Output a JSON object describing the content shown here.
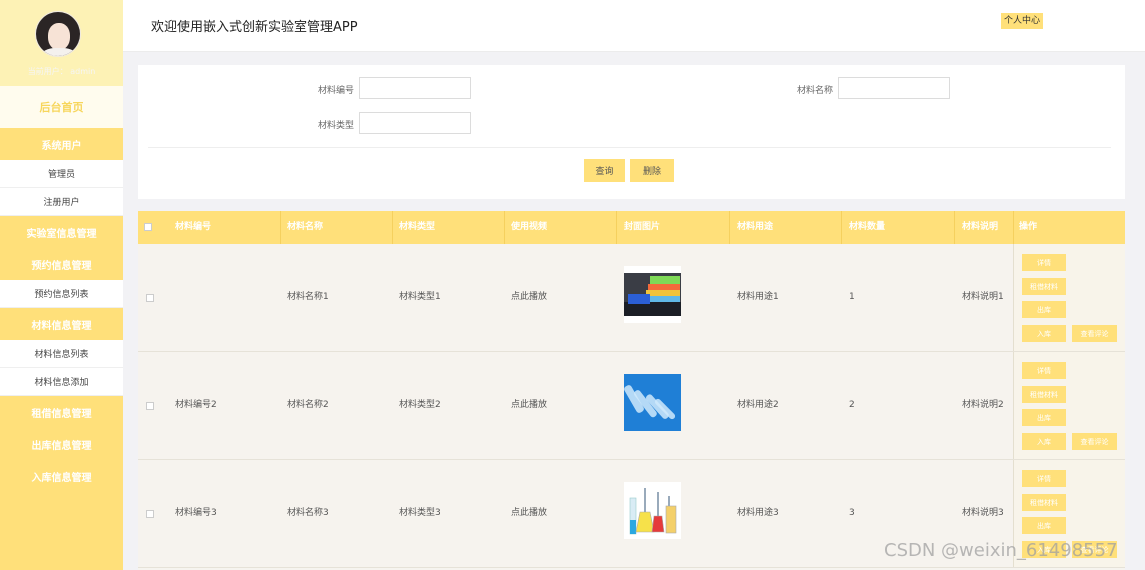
{
  "sidebar": {
    "user_line": "当前用户： admin",
    "home": "后台首页",
    "groups": [
      {
        "title": "系统用户",
        "items": [
          "管理员",
          "注册用户"
        ]
      },
      {
        "title": "实验室信息管理",
        "items": []
      },
      {
        "title": "预约信息管理",
        "items": [
          "预约信息列表"
        ]
      },
      {
        "title": "材料信息管理",
        "items": [
          "材料信息列表",
          "材料信息添加"
        ]
      },
      {
        "title": "租借信息管理",
        "items": []
      },
      {
        "title": "出库信息管理",
        "items": []
      },
      {
        "title": "入库信息管理",
        "items": []
      }
    ]
  },
  "header": {
    "title": "欢迎使用嵌入式创新实验室管理APP",
    "profile_button": "个人中心"
  },
  "search": {
    "code_label": "材料编号",
    "name_label": "材料名称",
    "type_label": "材料类型",
    "query_button": "查询",
    "delete_button": "删除"
  },
  "table": {
    "headers": [
      "材料编号",
      "材料名称",
      "材料类型",
      "使用视频",
      "封面图片",
      "材料用途",
      "材料数量",
      "材料说明",
      "操作"
    ],
    "rows": [
      {
        "code": "",
        "name": "材料名称1",
        "type": "材料类型1",
        "video": "点此播放",
        "usage": "材料用途1",
        "qty": "1",
        "desc": "材料说明1",
        "image": "test-tube-rack"
      },
      {
        "code": "材料编号2",
        "name": "材料名称2",
        "type": "材料类型2",
        "video": "点此播放",
        "usage": "材料用途2",
        "qty": "2",
        "desc": "材料说明2",
        "image": "glass-tubes"
      },
      {
        "code": "材料编号3",
        "name": "材料名称3",
        "type": "材料类型3",
        "video": "点此播放",
        "usage": "材料用途3",
        "qty": "3",
        "desc": "材料说明3",
        "image": "lab-flasks"
      }
    ],
    "ops": [
      "详情",
      "租借材料",
      "出库",
      "入库",
      "查看评论"
    ]
  },
  "watermark": "CSDN @weixin_61498557",
  "colors": {
    "accent": "#ffe07a",
    "sidebar_top": "#fdf2b5"
  }
}
